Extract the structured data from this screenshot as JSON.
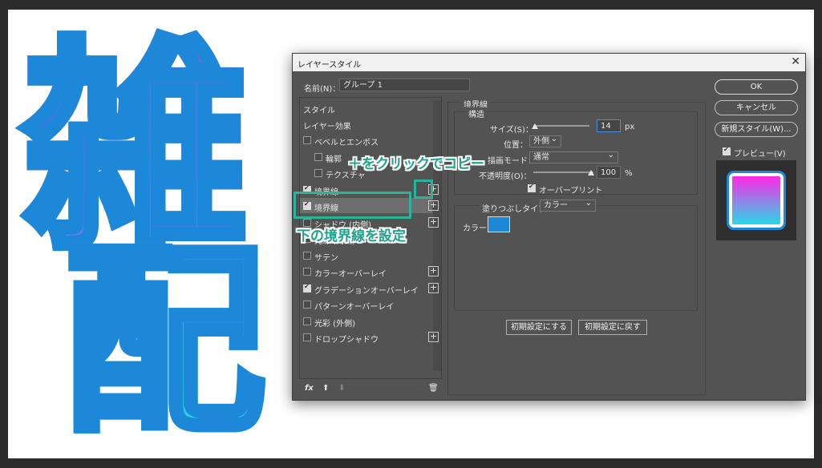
{
  "background": {
    "char1": "雑",
    "char2": "配"
  },
  "dialog": {
    "title": "レイヤースタイル",
    "close": "✕",
    "name_label": "名前(N)：",
    "name_value": "グループ 1",
    "list": {
      "style": "スタイル",
      "layer_effects": "レイヤー効果",
      "items": [
        {
          "label": "ベベルとエンボス",
          "checked": false,
          "plus": false
        },
        {
          "label": "輪郭",
          "checked": false,
          "plus": false
        },
        {
          "label": "テクスチャ",
          "checked": false,
          "plus": false
        },
        {
          "label": "境界線",
          "checked": true,
          "plus": true
        },
        {
          "label": "境界線",
          "checked": true,
          "plus": true
        },
        {
          "label": "シャドウ (内側)",
          "checked": false,
          "plus": true
        },
        {
          "label": "光彩 (内側)",
          "checked": false,
          "plus": false
        },
        {
          "label": "サテン",
          "checked": false,
          "plus": false
        },
        {
          "label": "カラーオーバーレイ",
          "checked": false,
          "plus": true
        },
        {
          "label": "グラデーションオーバーレイ",
          "checked": true,
          "plus": true
        },
        {
          "label": "パターンオーバーレイ",
          "checked": false,
          "plus": false
        },
        {
          "label": "光彩 (外側)",
          "checked": false,
          "plus": false
        },
        {
          "label": "ドロップシャドウ",
          "checked": false,
          "plus": true
        }
      ],
      "footer": {
        "fx": "fx",
        "up": "⬆",
        "down": "⬇",
        "trash": "🗑"
      }
    },
    "stroke": {
      "section_title": "境界線",
      "structure_title": "構造",
      "size_label": "サイズ(S)：",
      "size_value": "14",
      "size_unit": "px",
      "position_label": "位置：",
      "position_value": "外側",
      "blend_label": "描画モード：",
      "blend_value": "通常",
      "opacity_label": "不透明度(O)：",
      "opacity_value": "100",
      "opacity_unit": "%",
      "overprint_label": "オーバープリント",
      "fill_type_label": "塗りつぶしタイプ：",
      "fill_type_value": "カラー",
      "color_label": "カラー：",
      "color_swatch": "#1e88d8",
      "make_default": "初期設定にする",
      "reset_default": "初期設定に戻す"
    },
    "buttons": {
      "ok": "OK",
      "cancel": "キャンセル",
      "new_style": "新規スタイル(W)...",
      "preview": "プレビュー(V)"
    }
  },
  "annotations": {
    "top": "＋をクリックでコピー",
    "bottom": "下の境界線を設定",
    "color": "#2bb39a"
  }
}
